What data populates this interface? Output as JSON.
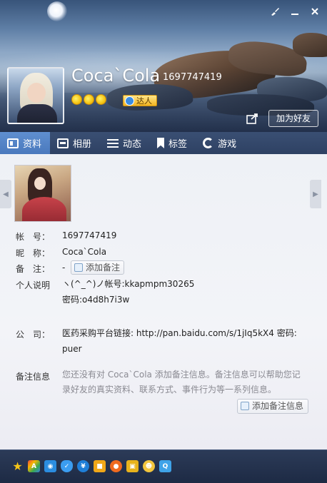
{
  "header": {
    "nickname": "Coca`Cola",
    "qq_number": "1697747419",
    "badge_label": "达人",
    "add_friend_label": "加为好友"
  },
  "tabs": [
    {
      "label": "资料",
      "icon": "profile-card-icon",
      "active": true
    },
    {
      "label": "相册",
      "icon": "album-icon",
      "active": false
    },
    {
      "label": "动态",
      "icon": "feed-icon",
      "active": false
    },
    {
      "label": "标签",
      "icon": "tag-icon",
      "active": false
    },
    {
      "label": "游戏",
      "icon": "game-icon",
      "active": false
    }
  ],
  "profile": {
    "account_label": "帐　号：",
    "account_value": "1697747419",
    "nickname_label": "昵　称：",
    "nickname_value": "Coca`Cola",
    "remark_label": "备　注：",
    "remark_value": "-",
    "add_remark_label": "添加备注",
    "signature_label": "个人说明",
    "signature_line1": "ヽ(^_^)ノ帐号:kkapmpm30265",
    "signature_line2": "密码:o4d8h7i3w",
    "company_label": "公　司：",
    "company_value": "医药采购平台链接: http://pan.baidu.com/s/1jIq5kX4 密码: puer",
    "note_label": "备注信息",
    "note_value": "您还没有对 Coca`Cola 添加备注信息。备注信息可以帮助您记录好友的真实资料、联系方式、事件行为等一系列信息。",
    "add_note_label": "添加备注信息"
  },
  "bottom_bar": {
    "icons": [
      "star-icon",
      "app-icon",
      "camera-icon",
      "shield-icon",
      "pay-icon",
      "book-icon",
      "orange-circle-icon",
      "gift-icon",
      "pet-icon",
      "qq-show-icon"
    ]
  },
  "colors": {
    "tab_bar": "#2e4163",
    "tab_active": "#4a79bd",
    "bottom_bar": "#1d2a44",
    "note_text": "#8a8a92"
  }
}
